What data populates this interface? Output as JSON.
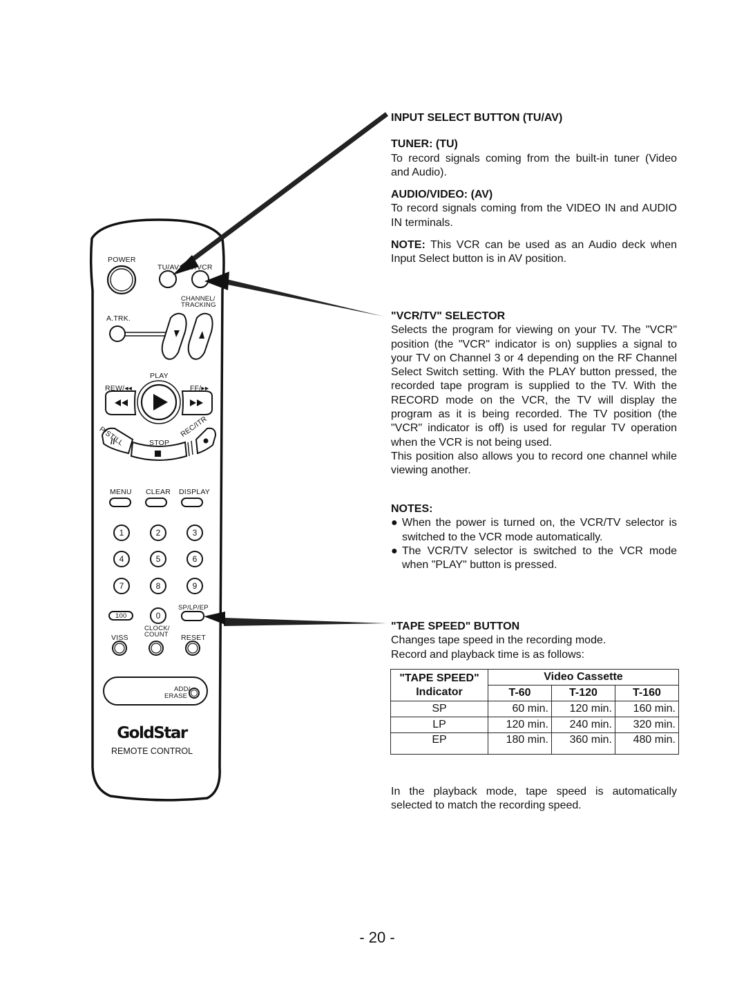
{
  "remote": {
    "labels": {
      "power": "POWER",
      "tu_av": "TU/AV",
      "tv_vcr": "TV/VCR",
      "channel": "CHANNEL/",
      "tracking": "TRACKING",
      "atrk": "A.TRK.",
      "play": "PLAY",
      "rew": "REW/◂◂",
      "ff": "FF/▸▸",
      "pstill": "P/STILL",
      "stop": "STOP",
      "recitr": "REC/ITR",
      "menu": "MENU",
      "clear": "CLEAR",
      "display": "DISPLAY",
      "splpep": "SP/LP/EP",
      "hundred": "100",
      "viss": "VISS",
      "clock": "CLOCK/",
      "count": "COUNT",
      "reset": "RESET",
      "add": "ADD/",
      "erase": "ERASE"
    },
    "digits": [
      "1",
      "2",
      "3",
      "4",
      "5",
      "6",
      "7",
      "8",
      "9",
      "0"
    ],
    "brand": "GoldStar",
    "caption": "REMOTE CONTROL"
  },
  "sections": {
    "input_select": {
      "heading": "INPUT SELECT BUTTON (TU/AV)",
      "tuner_heading": "TUNER: (TU)",
      "tuner_text": "To record signals coming from the built-in tuner (Video and Audio).",
      "av_heading": "AUDIO/VIDEO: (AV)",
      "av_text": "To record signals coming from the VIDEO IN and AUDIO IN terminals.",
      "note_label": "NOTE:",
      "note_text": " This VCR can be used as an Audio deck when Input Select button is in AV position."
    },
    "vcr_tv": {
      "heading": "\"VCR/TV\" SELECTOR",
      "text": "Selects the program for viewing on your TV. The \"VCR\" position (the \"VCR\" indicator is on) supplies a signal to your TV on Channel 3 or 4 depending on the RF Channel Select Switch setting. With the PLAY button pressed, the recorded tape program is supplied to the TV. With the RECORD mode on the VCR, the TV will display the program as it is being recorded. The TV position (the \"VCR\" indicator is off) is used for regular TV operation when the VCR is not being used.",
      "text2": "This position also allows you to record one channel while viewing another."
    },
    "notes": {
      "heading": "NOTES:",
      "items": [
        "When the power is turned on, the VCR/TV selector is switched to the VCR mode automatically.",
        "The VCR/TV selector is switched to the VCR mode when \"PLAY\" button is pressed."
      ]
    },
    "tape_speed": {
      "heading": "\"TAPE SPEED\" BUTTON",
      "line1": "Changes tape speed in the recording mode.",
      "line2": "Record and playback time is as follows:",
      "footer": "In the playback mode, tape speed is automatically selected to match the recording speed."
    }
  },
  "table": {
    "header_col1_line1": "\"TAPE SPEED\"",
    "header_col1_line2": "Indicator",
    "group_header": "Video Cassette",
    "columns": [
      "T-60",
      "T-120",
      "T-160"
    ],
    "rows": [
      {
        "mode": "SP",
        "values": [
          "60 min.",
          "120 min.",
          "160 min."
        ]
      },
      {
        "mode": "LP",
        "values": [
          "120 min.",
          "240 min.",
          "320 min."
        ]
      },
      {
        "mode": "EP",
        "values": [
          "180 min.",
          "360 min.",
          "480 min."
        ]
      }
    ]
  },
  "page_number": "- 20 -"
}
